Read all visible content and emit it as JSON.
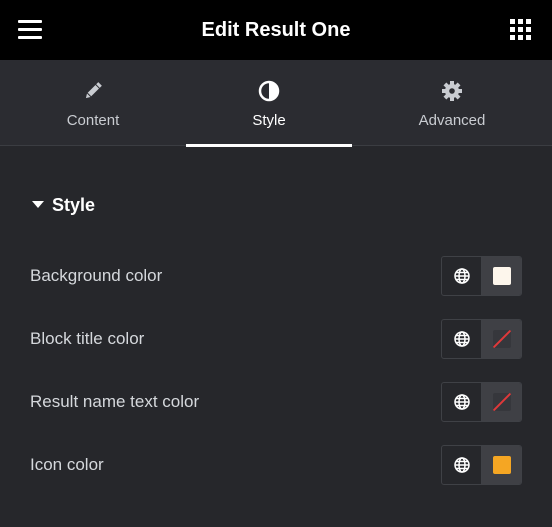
{
  "header": {
    "title": "Edit Result One",
    "menu_icon": "hamburger-icon",
    "apps_icon": "grid-icon"
  },
  "tabs": [
    {
      "label": "Content",
      "icon": "pencil-icon",
      "active": false
    },
    {
      "label": "Style",
      "icon": "half-circle-icon",
      "active": true
    },
    {
      "label": "Advanced",
      "icon": "gear-icon",
      "active": false
    }
  ],
  "section": {
    "title": "Style",
    "expanded": true
  },
  "rows": [
    {
      "label": "Background color",
      "color": "#fdf6ec",
      "set": true
    },
    {
      "label": "Block title color",
      "color": "",
      "set": false
    },
    {
      "label": "Result name text color",
      "color": "",
      "set": false
    },
    {
      "label": "Icon color",
      "color": "#f5a623",
      "set": true
    }
  ],
  "colors": {
    "header_bg": "#000000",
    "panel_bg": "#26272b",
    "tabs_bg": "#2b2c31",
    "text": "#d5d8dc",
    "active": "#ffffff"
  }
}
